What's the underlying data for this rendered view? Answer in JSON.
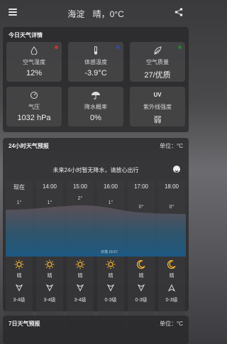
{
  "header": {
    "location": "海淀",
    "weather": "晴，0°C"
  },
  "today": {
    "title": "今日天气详情",
    "tiles": [
      {
        "label": "空气湿度",
        "value": "12%",
        "icon": "humidity-icon",
        "dot_color": "#c0392b"
      },
      {
        "label": "体感温度",
        "value": "-3.9°C",
        "icon": "thermometer-icon",
        "dot_color": "#2e4ea0"
      },
      {
        "label": "空气质量",
        "value": "27/优质",
        "icon": "leaf-icon",
        "dot_color": "#2e7d32"
      },
      {
        "label": "气压",
        "value": "1032 hPa",
        "icon": "pressure-gauge-icon"
      },
      {
        "label": "降水概率",
        "value": "0%",
        "icon": "umbrella-icon"
      },
      {
        "label": "紫外线强度",
        "value": "弱",
        "icon": "uv-icon",
        "icon_text": "UV"
      }
    ]
  },
  "hourly": {
    "title": "24小时天气预报",
    "unit": "单位：°C",
    "notice": "未来24小时暂无降水，请放心出行",
    "sunset": "日落 16:57",
    "hours": [
      {
        "time": "现在",
        "temp": "1°",
        "cond": "晴",
        "icon": "sun-icon",
        "wind": "3-4级"
      },
      {
        "time": "14:00",
        "temp": "1°",
        "cond": "晴",
        "icon": "sun-icon",
        "wind": "3-4级"
      },
      {
        "time": "15:00",
        "temp": "2°",
        "cond": "晴",
        "icon": "sun-icon",
        "wind": "3-4级"
      },
      {
        "time": "16:00",
        "temp": "1°",
        "cond": "晴",
        "icon": "sun-icon",
        "wind": "0-3级"
      },
      {
        "time": "17:00",
        "temp": "0°",
        "cond": "晴",
        "icon": "moon-icon",
        "wind": "0-3级"
      },
      {
        "time": "18:00",
        "temp": "0°",
        "cond": "晴",
        "icon": "moon-icon",
        "wind": "0-3级"
      }
    ]
  },
  "weekly": {
    "title": "7日天气预报",
    "unit": "单位：°C"
  }
}
